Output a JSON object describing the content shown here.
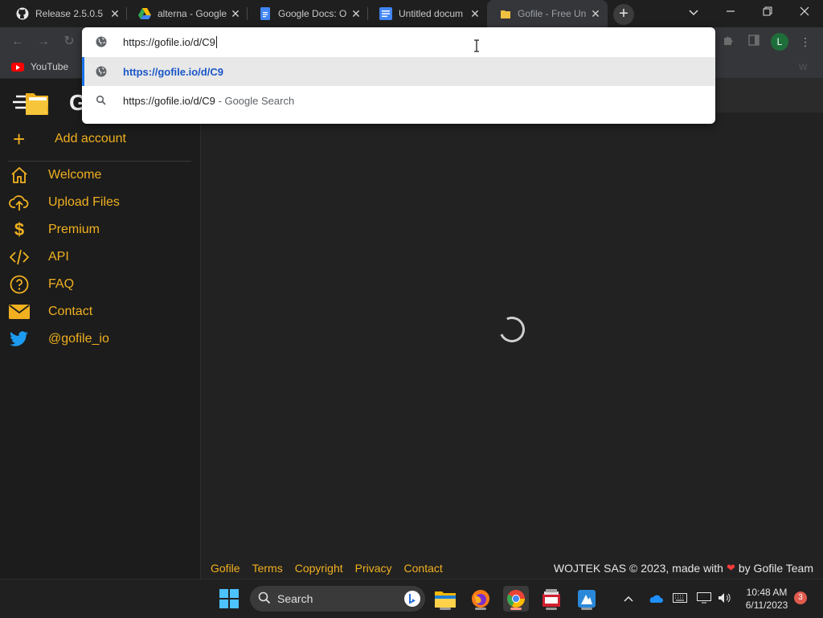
{
  "browser": {
    "tabs": [
      {
        "title": "Release 2.5.0.5 ·",
        "icon": "github-icon"
      },
      {
        "title": "alterna - Google",
        "icon": "google-drive-icon"
      },
      {
        "title": "Google Docs: O",
        "icon": "google-docs-icon"
      },
      {
        "title": "Untitled docum",
        "icon": "google-docs-icon"
      },
      {
        "title": "Gofile - Free Un",
        "icon": "gofile-icon"
      }
    ],
    "profile_initial": "L",
    "bookmark_youtube": "YouTube",
    "bookmark_right_fragment": "W"
  },
  "omnibox": {
    "input_text": "https://gofile.io/d/C9",
    "suggestions": [
      {
        "text": "https://gofile.io/d/C9",
        "suffix": "",
        "icon": "globe-icon"
      },
      {
        "text": "https://gofile.io/d/C9",
        "suffix": " - Google Search",
        "icon": "search-icon"
      }
    ]
  },
  "sidebar": {
    "brand_letter": "G",
    "add_account": "Add account",
    "items": [
      {
        "label": "Welcome",
        "icon": "home-icon"
      },
      {
        "label": "Upload Files",
        "icon": "cloud-upload-icon"
      },
      {
        "label": "Premium",
        "icon": "dollar-icon"
      },
      {
        "label": "API",
        "icon": "code-icon"
      },
      {
        "label": "FAQ",
        "icon": "question-icon"
      },
      {
        "label": "Contact",
        "icon": "envelope-icon"
      },
      {
        "label": "@gofile_io",
        "icon": "twitter-icon"
      }
    ]
  },
  "footer": {
    "links": [
      "Gofile",
      "Terms",
      "Copyright",
      "Privacy",
      "Contact"
    ],
    "copyright_prefix": "WOJTEK SAS © 2023, made with",
    "copyright_suffix": "by Gofile Team"
  },
  "taskbar": {
    "search_label": "Search",
    "time": "10:48 AM",
    "date": "6/11/2023",
    "notification_count": "3"
  },
  "colors": {
    "accent": "#f0b020",
    "page_bg": "#222222",
    "sidebar_bg": "#1c1c1c",
    "link_blue": "#1a56c8"
  }
}
